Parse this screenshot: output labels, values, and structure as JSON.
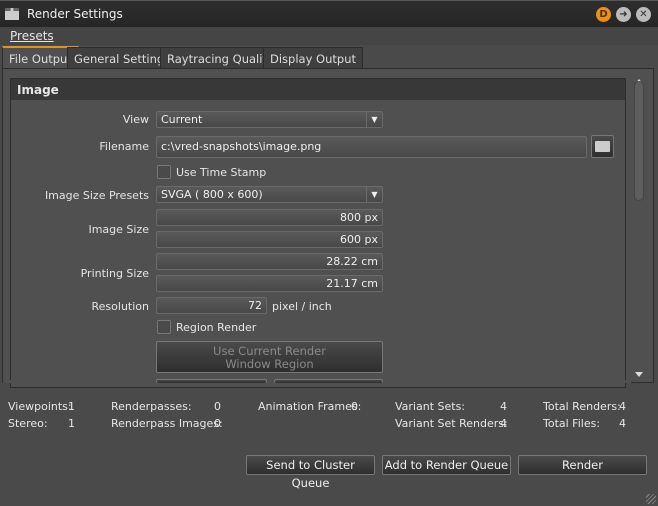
{
  "window": {
    "title": "Render Settings",
    "icon": "clapperboard-icon"
  },
  "menu": {
    "presets": "Presets"
  },
  "tabs": [
    "File Output",
    "General Settings",
    "Raytracing Quality",
    "Display Output"
  ],
  "group": {
    "title": "Image"
  },
  "form": {
    "view_label": "View",
    "view_value": "Current",
    "filename_label": "Filename",
    "filename_value": "c:\\vred-snapshots\\image.png",
    "timestamp_label": "Use Time Stamp",
    "presets_label": "Image Size Presets",
    "presets_value": "SVGA ( 800 x  600)",
    "image_size_label": "Image Size",
    "width_value": "800 px",
    "height_value": "600 px",
    "printing_size_label": "Printing Size",
    "print_w": "28.22 cm",
    "print_h": "21.17 cm",
    "resolution_label": "Resolution",
    "resolution_value": "72",
    "resolution_unit": "pixel / inch",
    "region_label": "Region Render",
    "region_btn_1": "Use Current Render",
    "region_btn_2": "Window Region"
  },
  "stats": {
    "viewpoints_l": "Viewpoints:",
    "viewpoints": "1",
    "stereo_l": "Stereo:",
    "stereo": "1",
    "renderpasses_l": "Renderpasses:",
    "renderpasses": "0",
    "rp_images_l": "Renderpass Images:",
    "rp_images": "0",
    "anim_l": "Animation Frames:",
    "anim": "0",
    "vsets_l": "Variant Sets:",
    "vsets": "4",
    "vset_renders_l": "Variant Set Renders:",
    "vset_renders": "4",
    "total_renders_l": "Total Renders:",
    "total_renders": "4",
    "total_files_l": "Total Files:",
    "total_files": "4"
  },
  "buttons": {
    "cluster": "Send to Cluster Queue",
    "queue": "Add to Render Queue",
    "render": "Render"
  },
  "colors": {
    "accent": "#e8901c"
  }
}
